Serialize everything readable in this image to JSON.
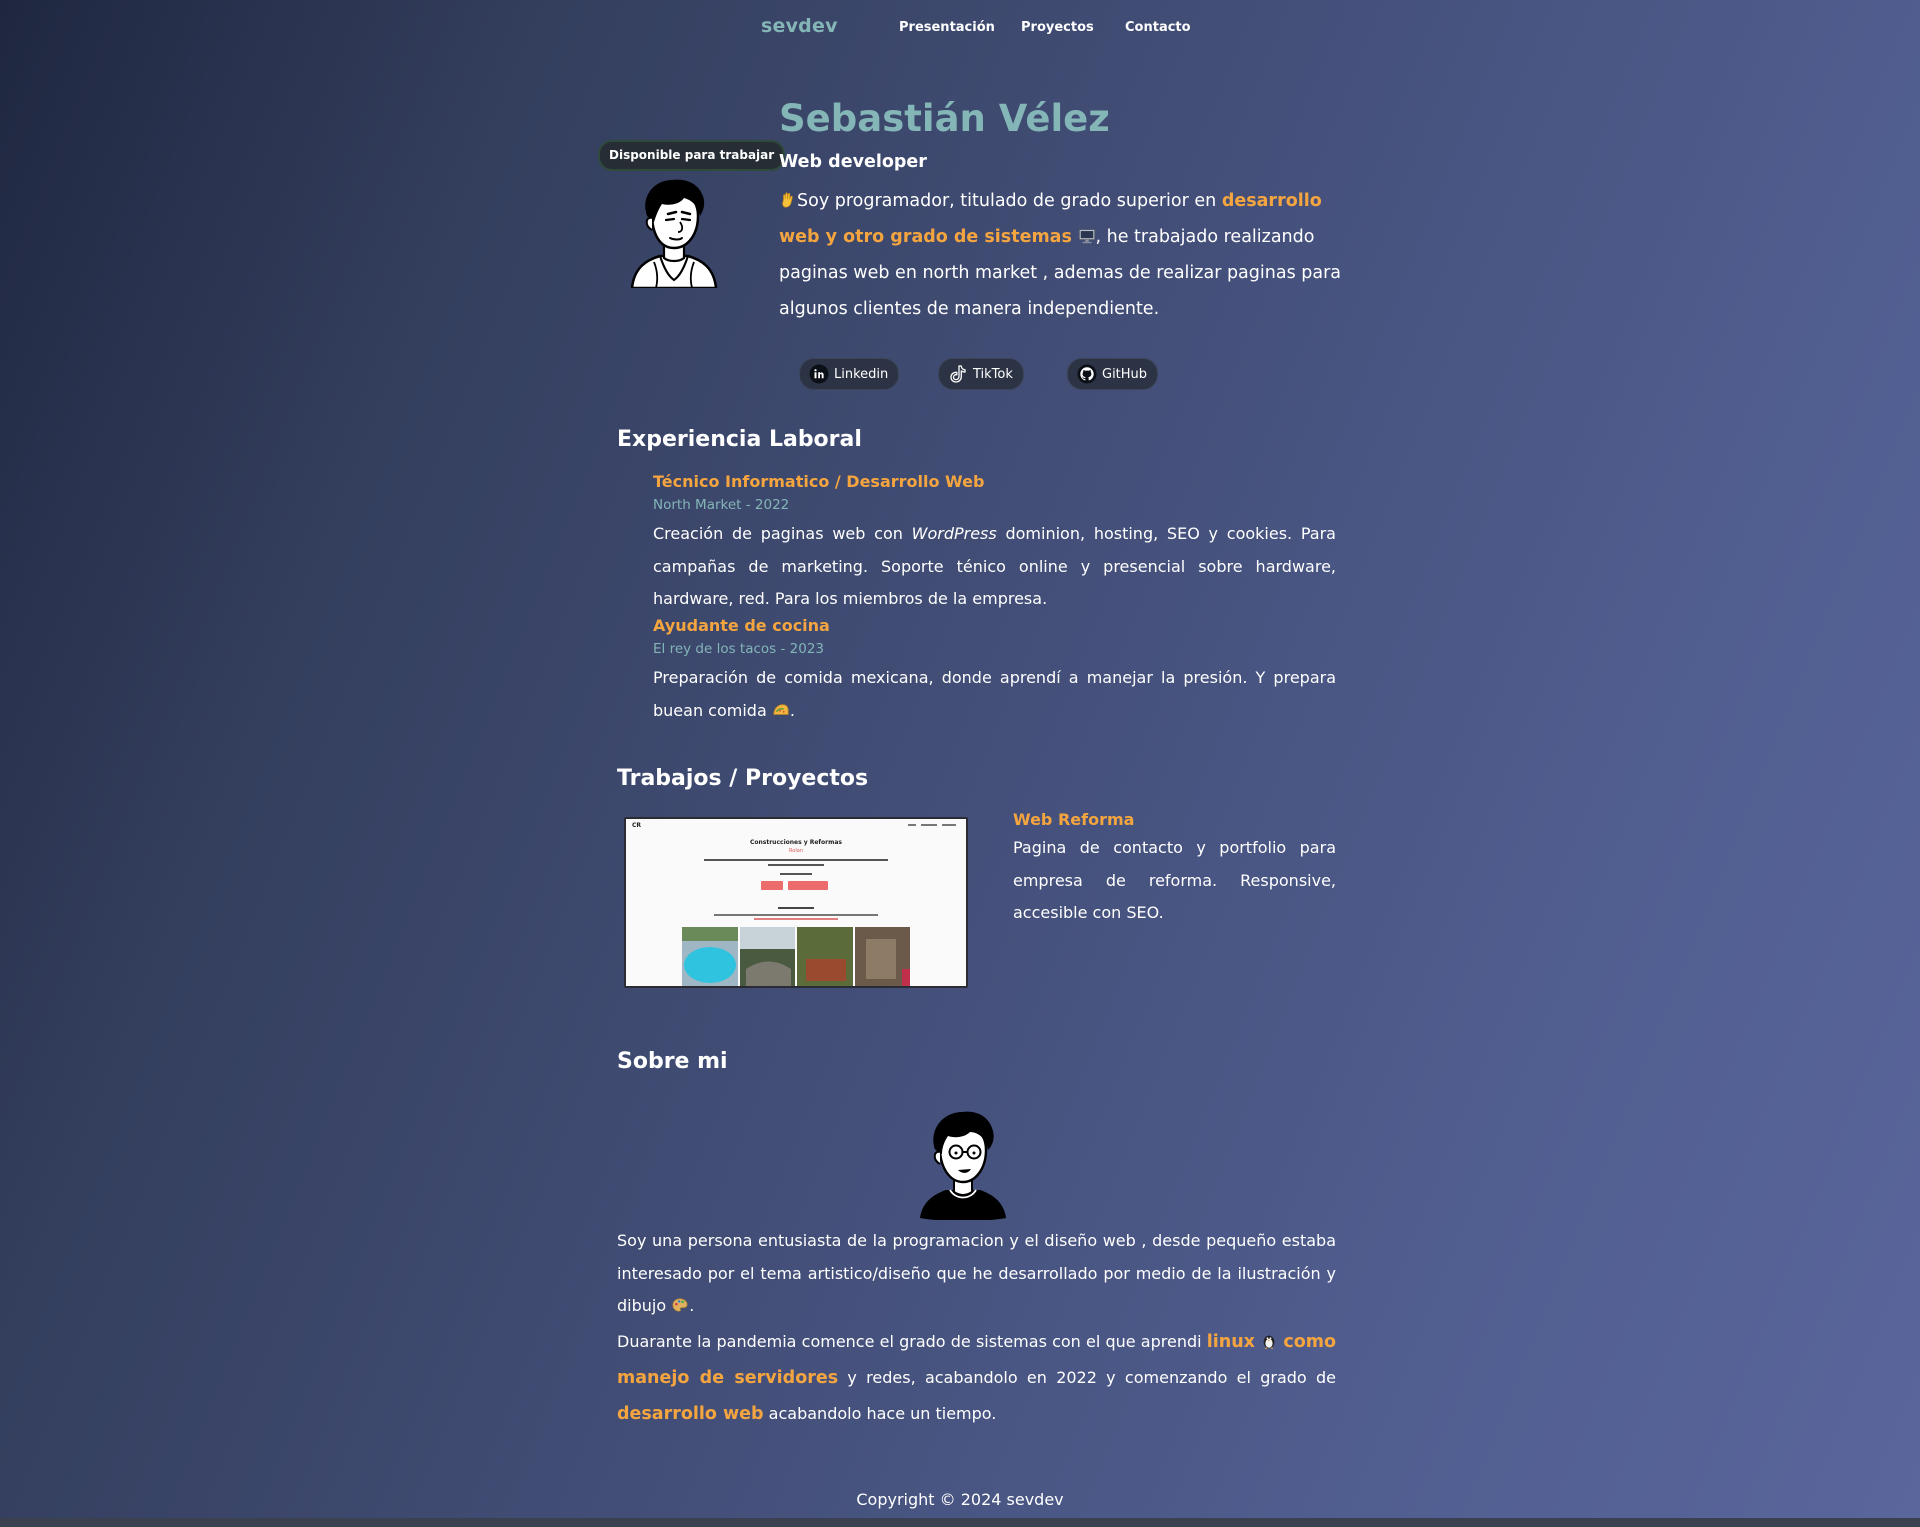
{
  "nav": {
    "brand": "sevdev",
    "links": [
      "Presentación",
      "Proyectos",
      "Contacto"
    ]
  },
  "hero": {
    "badge": "Disponible para trabajar",
    "name": "Sebastián Vélez",
    "role": "Web developer",
    "bio_part1": "Soy programador, titulado de grado superior en ",
    "bio_highlight": "desarrollo web y otro grado de sistemas",
    "bio_part2": ", he trabajado realizando paginas web en north market , ademas de realizar paginas para algunos clientes de manera independiente."
  },
  "socials": [
    {
      "label": "Linkedin",
      "icon": "linkedin-icon"
    },
    {
      "label": "TikTok",
      "icon": "tiktok-icon"
    },
    {
      "label": "GitHub",
      "icon": "github-icon"
    }
  ],
  "experience": {
    "title": "Experiencia Laboral",
    "jobs": [
      {
        "title": "Técnico Informatico / Desarrollo Web",
        "meta": "North Market - 2022",
        "desc_part1": "Creación de paginas web con ",
        "desc_em": "WordPress",
        "desc_part2": " dominion, hosting, SEO y cookies. Para campañas de marketing. Soporte ténico online y presencial sobre hardware, hardware, red. Para los miembros de la empresa."
      },
      {
        "title": "Ayudante de cocina",
        "meta": "El rey de los tacos - 2023",
        "desc": "Preparación de comida mexicana, donde aprendí a manejar la presión. Y prepara buean comida",
        "desc_end": "."
      }
    ]
  },
  "projects": {
    "title": "Trabajos / Proyectos",
    "items": [
      {
        "name": "Web Reforma",
        "desc": "Pagina de contacto y portfolio para empresa de reforma. Responsive, accesible con SEO.",
        "screenshot_title": "Construcciones y Reformas",
        "screenshot_subtitle": "Rolan",
        "screenshot_logo": "CR"
      }
    ]
  },
  "about": {
    "title": "Sobre mi",
    "p1": "Soy una persona entusiasta de la programacion y el diseño web , desde pequeño estaba interesado por el tema artistico/diseño que he desarrollado por medio de la ilustración y dibujo",
    "p1_end": ".",
    "p2_part1": "Duarante la pandemia comence el grado de sistemas con el que aprendi ",
    "p2_hl1": "linux",
    "p2_hl2": "como manejo de servidores",
    "p2_part2": " y redes, acabandolo en 2022 y comenzando el grado de ",
    "p2_hl3": "desarrollo web",
    "p2_part3": " acabandolo hace un tiempo."
  },
  "footer": {
    "text": "Copyright © 2024 sevdev"
  },
  "colors": {
    "accent": "#f5a53f",
    "teal": "#84b5b7"
  }
}
